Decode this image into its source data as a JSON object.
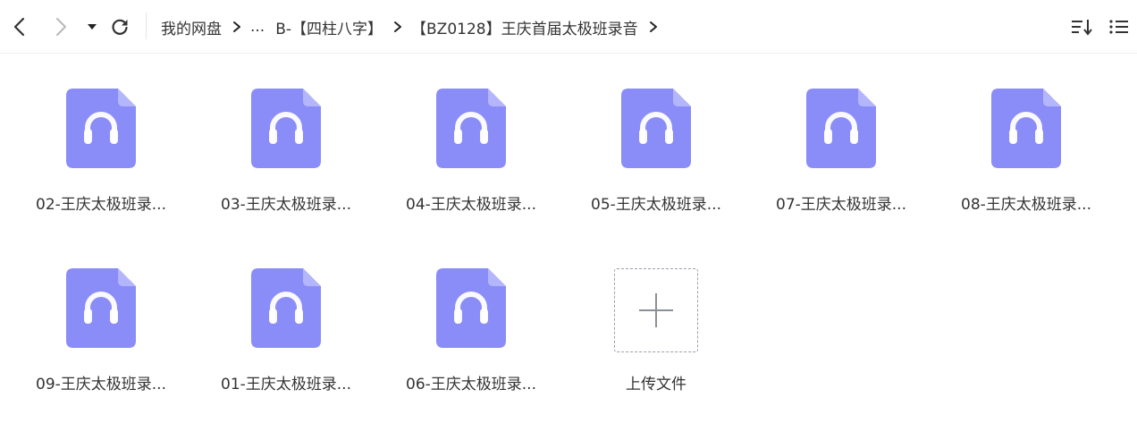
{
  "breadcrumb": {
    "items": [
      "我的网盘",
      "...",
      "B-【四柱八字】",
      "【BZ0128】王庆首届太极班录音"
    ]
  },
  "files": [
    {
      "label": "02-王庆太极班录..."
    },
    {
      "label": "03-王庆太极班录..."
    },
    {
      "label": "04-王庆太极班录..."
    },
    {
      "label": "05-王庆太极班录..."
    },
    {
      "label": "07-王庆太极班录..."
    },
    {
      "label": "08-王庆太极班录..."
    },
    {
      "label": "09-王庆太极班录..."
    },
    {
      "label": "01-王庆太极班录..."
    },
    {
      "label": "06-王庆太极班录..."
    }
  ],
  "upload": {
    "label": "上传文件"
  },
  "colors": {
    "file_icon_fill": "#8a8cf8",
    "file_icon_fold": "#b4b6fb",
    "text": "#333333"
  },
  "icons": {
    "back": "chevron-left-icon",
    "forward": "chevron-right-icon",
    "dropdown": "triangle-down-icon",
    "refresh": "refresh-icon",
    "sort": "sort-icon",
    "list_view": "list-view-icon",
    "audio_file": "audio-file-icon",
    "upload": "plus-icon"
  }
}
